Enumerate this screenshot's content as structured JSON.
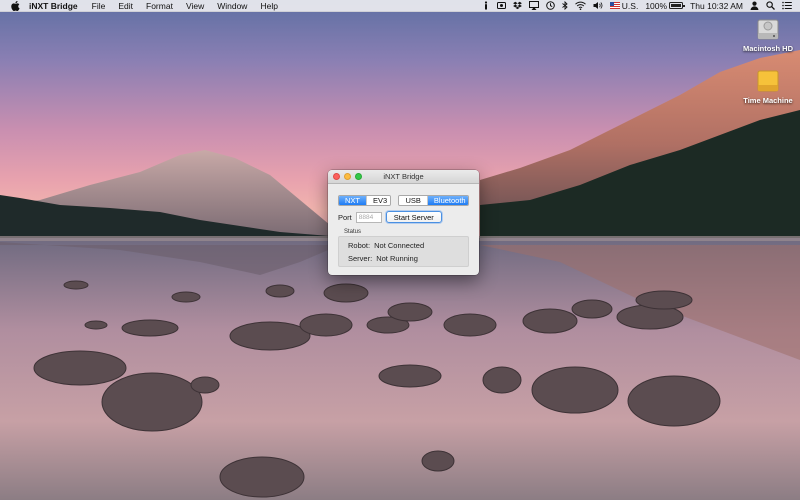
{
  "menubar": {
    "app_name": "iNXT Bridge",
    "items": [
      "File",
      "Edit",
      "Format",
      "View",
      "Window",
      "Help"
    ],
    "input_source": "U.S.",
    "battery_percent": "100%",
    "battery_level": 1.0,
    "clock": "Thu 10:32 AM"
  },
  "desktop": {
    "icons": [
      {
        "label": "Macintosh HD",
        "icon": "hard-drive-icon"
      },
      {
        "label": "Time Machine",
        "icon": "time-machine-icon"
      }
    ]
  },
  "window": {
    "title": "iNXT Bridge",
    "brick_options": [
      "NXT",
      "EV3"
    ],
    "brick_selected": "NXT",
    "connection_options": [
      "USB",
      "Bluetooth"
    ],
    "connection_selected": "Bluetooth",
    "port_label": "Port",
    "port_placeholder": "8884",
    "start_button": "Start Server",
    "status_title": "Status",
    "robot_label": "Robot:",
    "robot_value": "Not Connected",
    "server_label": "Server:",
    "server_value": "Not Running"
  },
  "colors": {
    "segment_selected": "#1e7cf5",
    "close": "#fc605c",
    "minimize": "#fdbc40",
    "maximize": "#34c84a"
  }
}
